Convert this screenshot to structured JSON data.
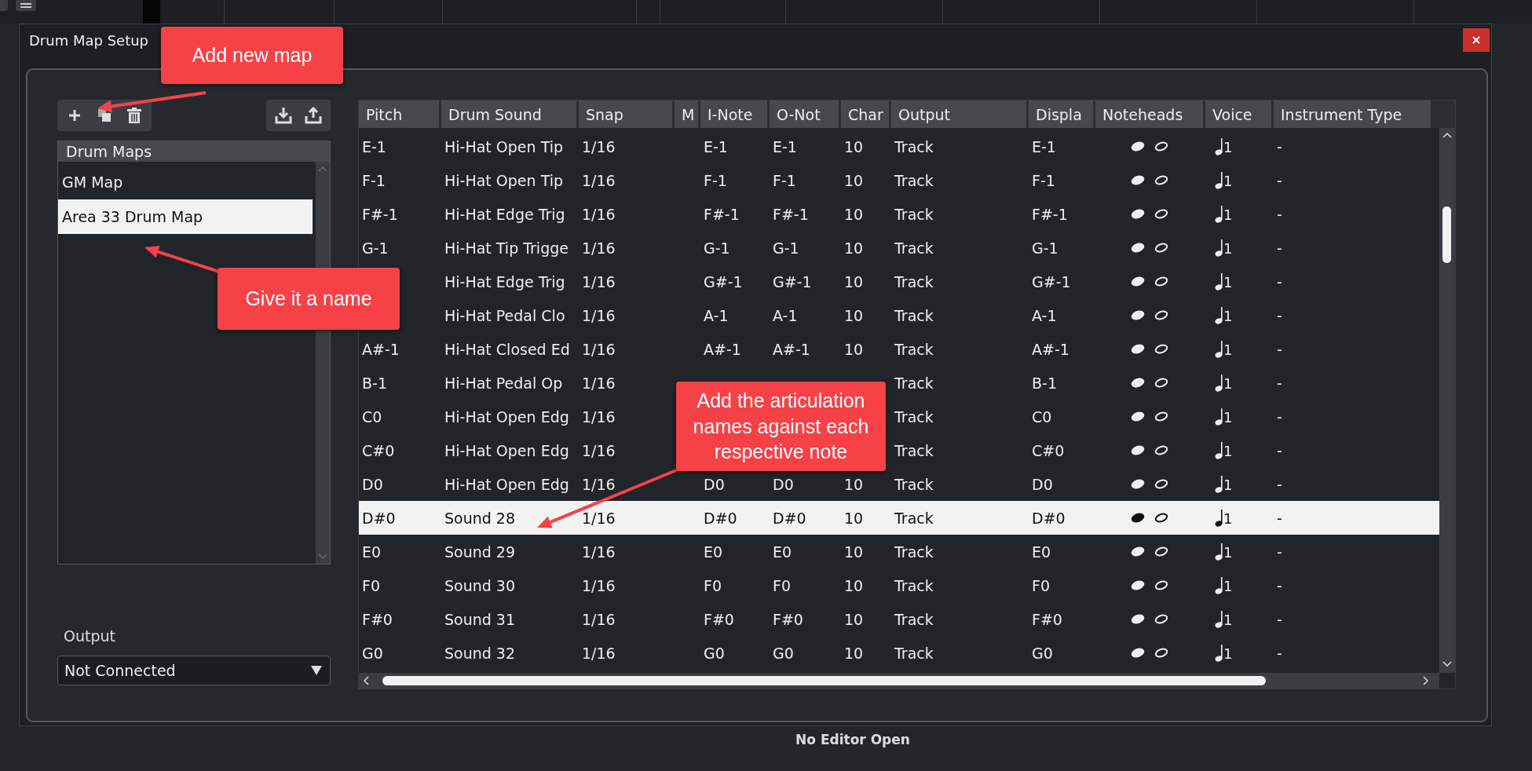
{
  "window": {
    "title": "Drum Map Setup"
  },
  "drum_maps": {
    "header": "Drum Maps",
    "items": [
      {
        "label": "GM Map",
        "selected": false
      },
      {
        "label": "Area 33 Drum Map",
        "selected": true
      }
    ]
  },
  "output": {
    "label": "Output",
    "value": "Not Connected"
  },
  "table": {
    "columns": [
      "Pitch",
      "Drum Sound",
      "Snap",
      "M",
      "I-Note",
      "O-Not",
      "Char",
      "Output",
      "Displa",
      "Noteheads",
      "Voice",
      "Instrument Type"
    ],
    "rows": [
      {
        "pitch": "E-1",
        "sound": "Hi-Hat Open Tip",
        "snap": "1/16",
        "i_note": "E-1",
        "o_note": "E-1",
        "channel": "10",
        "output": "Track",
        "display": "E-1",
        "voice": "1",
        "instrument": "-",
        "selected": false
      },
      {
        "pitch": "F-1",
        "sound": "Hi-Hat Open Tip",
        "snap": "1/16",
        "i_note": "F-1",
        "o_note": "F-1",
        "channel": "10",
        "output": "Track",
        "display": "F-1",
        "voice": "1",
        "instrument": "-",
        "selected": false
      },
      {
        "pitch": "F#-1",
        "sound": "Hi-Hat Edge Trig",
        "snap": "1/16",
        "i_note": "F#-1",
        "o_note": "F#-1",
        "channel": "10",
        "output": "Track",
        "display": "F#-1",
        "voice": "1",
        "instrument": "-",
        "selected": false
      },
      {
        "pitch": "G-1",
        "sound": "Hi-Hat Tip Trigge",
        "snap": "1/16",
        "i_note": "G-1",
        "o_note": "G-1",
        "channel": "10",
        "output": "Track",
        "display": "G-1",
        "voice": "1",
        "instrument": "-",
        "selected": false
      },
      {
        "sound": "Hi-Hat Edge Trig",
        "snap": "1/16",
        "i_note": "G#-1",
        "o_note": "G#-1",
        "channel": "10",
        "output": "Track",
        "display": "G#-1",
        "voice": "1",
        "instrument": "-",
        "selected": false
      },
      {
        "sound": "Hi-Hat Pedal Clo",
        "snap": "1/16",
        "i_note": "A-1",
        "o_note": "A-1",
        "channel": "10",
        "output": "Track",
        "display": "A-1",
        "voice": "1",
        "instrument": "-",
        "selected": false
      },
      {
        "pitch": "A#-1",
        "sound": "Hi-Hat Closed Ed",
        "snap": "1/16",
        "i_note": "A#-1",
        "o_note": "A#-1",
        "channel": "10",
        "output": "Track",
        "display": "A#-1",
        "voice": "1",
        "instrument": "-",
        "selected": false
      },
      {
        "pitch": "B-1",
        "sound": "Hi-Hat Pedal Op",
        "snap": "1/16",
        "output": "Track",
        "display": "B-1",
        "voice": "1",
        "instrument": "-",
        "selected": false
      },
      {
        "pitch": "C0",
        "sound": "Hi-Hat Open Edg",
        "snap": "1/16",
        "output": "Track",
        "display": "C0",
        "voice": "1",
        "instrument": "-",
        "selected": false
      },
      {
        "pitch": "C#0",
        "sound": "Hi-Hat Open Edg",
        "snap": "1/16",
        "output": "Track",
        "display": "C#0",
        "voice": "1",
        "instrument": "-",
        "selected": false
      },
      {
        "pitch": "D0",
        "sound": "Hi-Hat Open Edg",
        "snap": "1/16",
        "i_note": "D0",
        "o_note": "D0",
        "channel": "10",
        "output": "Track",
        "display": "D0",
        "voice": "1",
        "instrument": "-",
        "selected": false
      },
      {
        "pitch": "D#0",
        "sound": "Sound 28",
        "snap": "1/16",
        "i_note": "D#0",
        "o_note": "D#0",
        "channel": "10",
        "output": "Track",
        "display": "D#0",
        "voice": "1",
        "instrument": "-",
        "selected": true
      },
      {
        "pitch": "E0",
        "sound": "Sound 29",
        "snap": "1/16",
        "i_note": "E0",
        "o_note": "E0",
        "channel": "10",
        "output": "Track",
        "display": "E0",
        "voice": "1",
        "instrument": "-",
        "selected": false
      },
      {
        "pitch": "F0",
        "sound": "Sound 30",
        "snap": "1/16",
        "i_note": "F0",
        "o_note": "F0",
        "channel": "10",
        "output": "Track",
        "display": "F0",
        "voice": "1",
        "instrument": "-",
        "selected": false
      },
      {
        "pitch": "F#0",
        "sound": "Sound 31",
        "snap": "1/16",
        "i_note": "F#0",
        "o_note": "F#0",
        "channel": "10",
        "output": "Track",
        "display": "F#0",
        "voice": "1",
        "instrument": "-",
        "selected": false
      },
      {
        "pitch": "G0",
        "sound": "Sound 32",
        "snap": "1/16",
        "i_note": "G0",
        "o_note": "G0",
        "channel": "10",
        "output": "Track",
        "display": "G0",
        "voice": "1",
        "instrument": "-",
        "selected": false
      }
    ]
  },
  "status_bar": "No Editor Open",
  "callouts": [
    {
      "text": "Add new map"
    },
    {
      "text": "Give it a name"
    },
    {
      "text": "Add the articulation names against each respective note"
    }
  ]
}
